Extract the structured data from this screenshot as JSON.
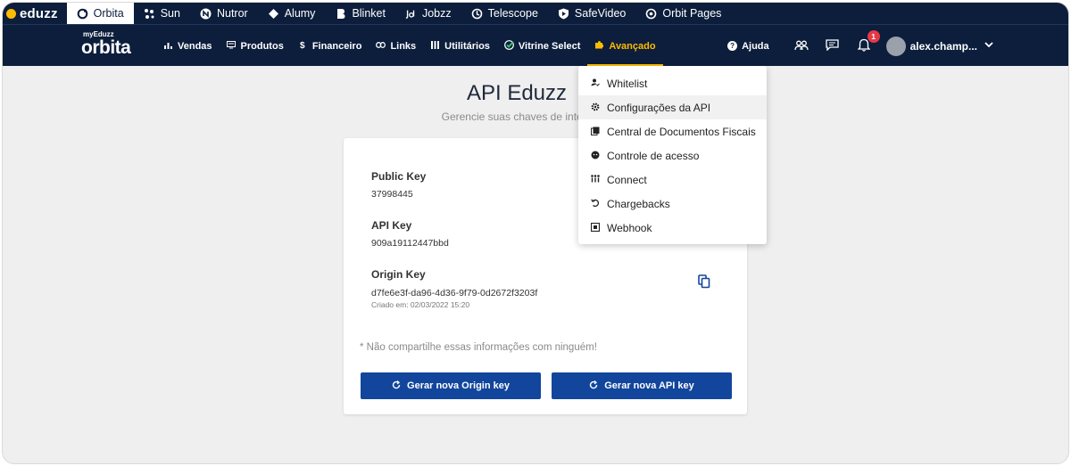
{
  "brandbar": {
    "logo": "eduzz",
    "apps": [
      {
        "label": "Orbita",
        "icon": "orbita-icon",
        "active": true
      },
      {
        "label": "Sun",
        "icon": "sun-icon",
        "active": false
      },
      {
        "label": "Nutror",
        "icon": "nutror-icon",
        "active": false
      },
      {
        "label": "Alumy",
        "icon": "alumy-icon",
        "active": false
      },
      {
        "label": "Blinket",
        "icon": "blinket-icon",
        "active": false
      },
      {
        "label": "Jobzz",
        "icon": "jobzz-icon",
        "active": false
      },
      {
        "label": "Telescope",
        "icon": "telescope-icon",
        "active": false
      },
      {
        "label": "SafeVideo",
        "icon": "safevideo-icon",
        "active": false
      },
      {
        "label": "Orbit Pages",
        "icon": "orbit-pages-icon",
        "active": false
      }
    ]
  },
  "mainnav": {
    "logo_small": "myEduzz",
    "logo_big": "orbita",
    "items": [
      {
        "label": "Vendas",
        "icon": "bar-chart-icon"
      },
      {
        "label": "Produtos",
        "icon": "product-icon"
      },
      {
        "label": "Financeiro",
        "icon": "dollar-icon"
      },
      {
        "label": "Links",
        "icon": "link-icon"
      },
      {
        "label": "Utilitários",
        "icon": "grid-icon"
      },
      {
        "label": "Vitrine Select",
        "icon": "check-badge-icon"
      },
      {
        "label": "Avançado",
        "icon": "puzzle-icon"
      }
    ],
    "help_label": "Ajuda",
    "notification_count": "1",
    "user_name": "alex.champ..."
  },
  "page": {
    "title": "API Eduzz",
    "subtitle": "Gerencie suas chaves de integr"
  },
  "card": {
    "public_key_label": "Public Key",
    "public_key_value": "37998445",
    "api_key_label": "API Key",
    "api_key_value": "909a19112447bbd",
    "origin_key_label": "Origin Key",
    "origin_key_value": "d7fe6e3f-da96-4d36-9f79-0d2672f3203f",
    "created": "Criado em: 02/03/2022 15:20",
    "warning": "* Não compartilhe essas informações com ninguém!",
    "btn_origin": "Gerar nova Origin key",
    "btn_api": "Gerar nova API key"
  },
  "dropdown": {
    "items": [
      {
        "label": "Whitelist",
        "icon": "person-check-icon"
      },
      {
        "label": "Configurações da API",
        "icon": "gear-icon"
      },
      {
        "label": "Central de Documentos Fiscais",
        "icon": "documents-icon"
      },
      {
        "label": "Controle de acesso",
        "icon": "face-icon"
      },
      {
        "label": "Connect",
        "icon": "connect-icon"
      },
      {
        "label": "Chargebacks",
        "icon": "refresh-icon"
      },
      {
        "label": "Webhook",
        "icon": "webhook-icon"
      }
    ]
  },
  "colors": {
    "navy": "#0c1e3c",
    "accent": "#fdbc00",
    "button": "#12469c",
    "badge": "#e53945"
  }
}
